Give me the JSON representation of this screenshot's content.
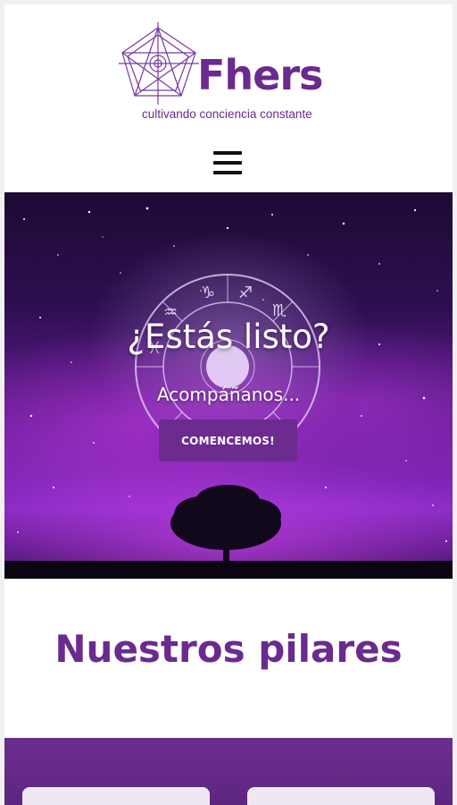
{
  "header": {
    "brand": "Fhers",
    "tagline": "cultivando conciencia constante",
    "menu_icon": "hamburger-menu-icon"
  },
  "hero": {
    "title": "¿Estás listo?",
    "subtitle": "Acompáñanos...",
    "button_label": "COMENCEMOS!"
  },
  "pilares": {
    "title": "Nuestros pilares"
  },
  "colors": {
    "brand_purple": "#6a2a8e",
    "button_purple": "#6b2b8f",
    "band_purple": "#6c2d8f"
  }
}
